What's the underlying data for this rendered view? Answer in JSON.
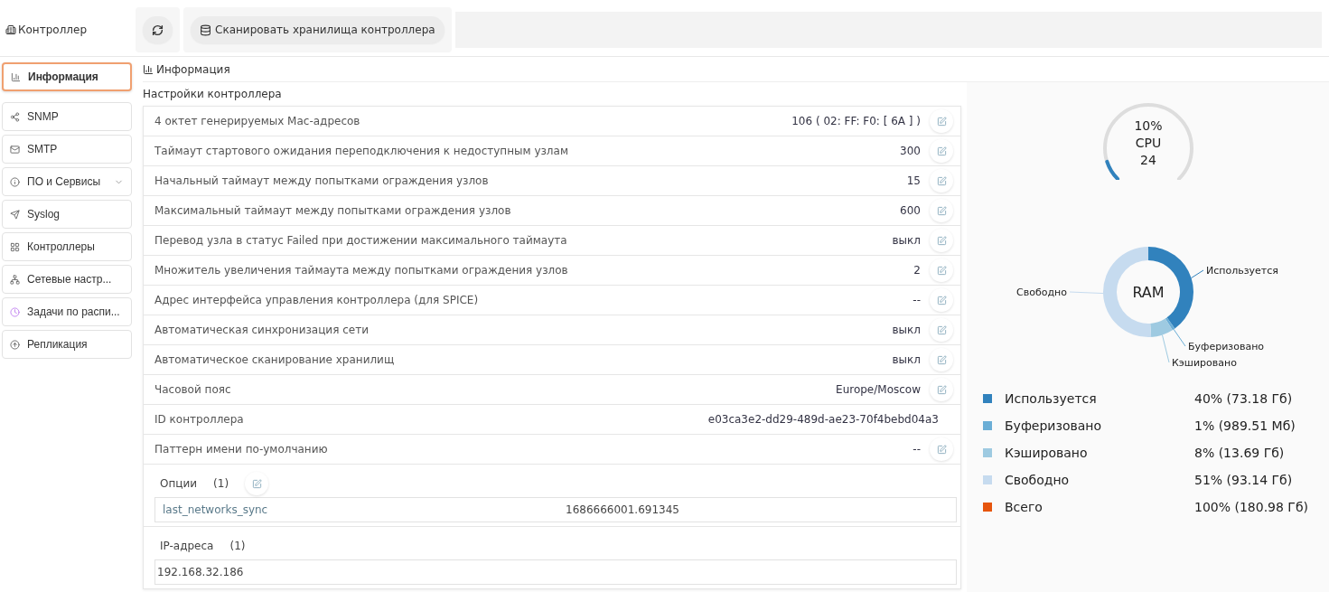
{
  "header": {
    "title": "Контроллер",
    "buttons": [
      {
        "kind": "refresh"
      },
      {
        "kind": "scan",
        "label": "Сканировать хранилища контроллера"
      }
    ]
  },
  "sidebar": {
    "items": [
      {
        "label": "Информация",
        "selected": true,
        "expandable": false
      },
      {
        "label": "SNMP",
        "selected": false,
        "expandable": false
      },
      {
        "label": "SMTP",
        "selected": false,
        "expandable": false
      },
      {
        "label": "ПО и Сервисы",
        "selected": false,
        "expandable": true
      },
      {
        "label": "Syslog",
        "selected": false,
        "expandable": false
      },
      {
        "label": "Контроллеры",
        "selected": false,
        "expandable": false
      },
      {
        "label": "Сетевые настр...",
        "selected": false,
        "expandable": false
      },
      {
        "label": "Задачи по распи...",
        "selected": false,
        "expandable": false
      },
      {
        "label": "Репликация",
        "selected": false,
        "expandable": false
      }
    ]
  },
  "section_title": "Информация",
  "settings": {
    "title": "Настройки контроллера",
    "rows": [
      {
        "label": "4 октет генерируемых Mac-адресов",
        "value": "106 ( 02: FF: F0: [ 6A ] )",
        "editable": true
      },
      {
        "label": "Таймаут стартового ожидания переподключения к недоступным узлам",
        "value": "300",
        "editable": true
      },
      {
        "label": "Начальный таймаут между попытками ограждения узлов",
        "value": "15",
        "editable": true
      },
      {
        "label": "Максимальный таймаут между попытками ограждения узлов",
        "value": "600",
        "editable": true
      },
      {
        "label": "Перевод узла в статус Failed при достижении максимального таймаута",
        "value": "выкл",
        "editable": true
      },
      {
        "label": "Множитель увеличения таймаута между попытками ограждения узлов",
        "value": "2",
        "editable": true
      },
      {
        "label": "Адрес интерфейса управления контроллера (для SPICE)",
        "value": "--",
        "editable": true
      },
      {
        "label": "Автоматическая синхронизация сети",
        "value": "выкл",
        "editable": true
      },
      {
        "label": "Автоматическое сканирование хранилищ",
        "value": "выкл",
        "editable": true
      },
      {
        "label": "Часовой пояс",
        "value": "Europe/Moscow",
        "editable": true
      },
      {
        "label": "ID контроллера",
        "value": "e03ca3e2-dd29-489d-ae23-70f4bebd04a3",
        "editable": false
      },
      {
        "label": "Паттерн имени по-умолчанию",
        "value": "--",
        "editable": true
      }
    ]
  },
  "options": {
    "title": "Опции",
    "count": "(1)",
    "editable": true,
    "rows": [
      {
        "key": "last_networks_sync",
        "value": "1686666001.691345"
      }
    ]
  },
  "ip_addresses": {
    "title": "IP-адреса",
    "count": "(1)",
    "rows": [
      "192.168.32.186"
    ]
  },
  "cpu": {
    "percent": "10%",
    "label": "CPU",
    "cores": "24",
    "level": 0.1
  },
  "ram": {
    "center": "RAM",
    "chart_data": {
      "type": "donut",
      "categories": [
        "Используется",
        "Буферизовано",
        "Кэшировано",
        "Свободно"
      ],
      "values": [
        40,
        1,
        8,
        51
      ]
    },
    "legend": [
      {
        "label": "Используется",
        "value": "40% (73.18 Гб)",
        "color": "#3182bd"
      },
      {
        "label": "Буферизовано",
        "value": "1% (989.51 Мб)",
        "color": "#6baed6"
      },
      {
        "label": "Кэшировано",
        "value": "8% (13.69 Гб)",
        "color": "#9ecae1"
      },
      {
        "label": "Свободно",
        "value": "51% (93.14 Гб)",
        "color": "#c6dbef"
      },
      {
        "label": "Всего",
        "value": "100% (180.98 Гб)",
        "color": "#e6550d"
      }
    ]
  }
}
